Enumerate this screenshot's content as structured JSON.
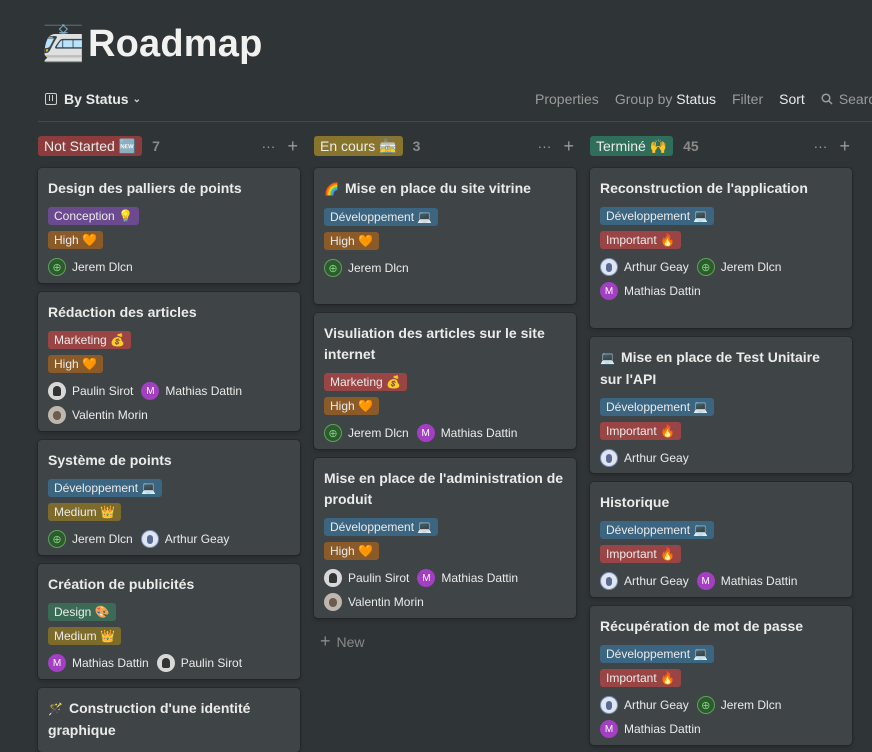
{
  "page": {
    "emoji": "🚈",
    "title": "Roadmap"
  },
  "toolbar": {
    "view_label": "By Status",
    "properties": "Properties",
    "group_prefix": "Group by",
    "group_value": "Status",
    "filter": "Filter",
    "sort": "Sort",
    "search": "Search"
  },
  "colors": {
    "not_started": "#8c3c3c",
    "en_cours": "#89742d",
    "termine": "#2e6e5a",
    "conception": "#6b4a8f",
    "high": "#8a5a28",
    "marketing": "#994545",
    "developpement": "#3b6580",
    "medium": "#7d6b2c",
    "design": "#3b6b57",
    "important": "#994545"
  },
  "columns": [
    {
      "label": "Not Started 🆕",
      "count": "7",
      "cards": [
        {
          "title": "Design des palliers de points",
          "tags": [
            [
              "Conception 💡",
              "conception"
            ],
            [
              "High 🧡",
              "high"
            ]
          ],
          "people": [
            [
              "Jerem Dlcn",
              "jerem"
            ]
          ]
        },
        {
          "title": "Rédaction des articles",
          "tags": [
            [
              "Marketing 💰",
              "marketing"
            ],
            [
              "High 🧡",
              "high"
            ]
          ],
          "people": [
            [
              "Paulin Sirot",
              "paulin"
            ],
            [
              "Mathias Dattin",
              "mathias"
            ],
            [
              "Valentin Morin",
              "valentin"
            ]
          ]
        },
        {
          "title": "Système de points",
          "tags": [
            [
              "Développement 💻",
              "developpement"
            ],
            [
              "Medium 👑",
              "medium"
            ]
          ],
          "people": [
            [
              "Jerem Dlcn",
              "jerem"
            ],
            [
              "Arthur Geay",
              "arthur"
            ]
          ]
        },
        {
          "title": "Création de publicités",
          "tags": [
            [
              "Design 🎨",
              "design"
            ],
            [
              "Medium 👑",
              "medium"
            ]
          ],
          "people": [
            [
              "Mathias Dattin",
              "mathias"
            ],
            [
              "Paulin Sirot",
              "paulin"
            ]
          ]
        },
        {
          "emoji": "🪄",
          "title": "Construction d'une identité graphique",
          "tags": [],
          "people": []
        }
      ]
    },
    {
      "label": "En cours 🚋",
      "count": "3",
      "new_label": "New",
      "cards": [
        {
          "emoji": "🌈",
          "title": "Mise en place du site vitrine",
          "tags": [
            [
              "Développement 💻",
              "developpement"
            ],
            [
              "High 🧡",
              "high"
            ]
          ],
          "people": [
            [
              "Jerem Dlcn",
              "jerem"
            ]
          ]
        },
        {
          "title": "Visuliation des articles sur le site internet",
          "tags": [
            [
              "Marketing 💰",
              "marketing"
            ],
            [
              "High 🧡",
              "high"
            ]
          ],
          "people": [
            [
              "Jerem Dlcn",
              "jerem"
            ],
            [
              "Mathias Dattin",
              "mathias"
            ]
          ]
        },
        {
          "title": "Mise en place de l'administration de produit",
          "tags": [
            [
              "Développement 💻",
              "developpement"
            ],
            [
              "High 🧡",
              "high"
            ]
          ],
          "people": [
            [
              "Paulin Sirot",
              "paulin"
            ],
            [
              "Mathias Dattin",
              "mathias"
            ],
            [
              "Valentin Morin",
              "valentin"
            ]
          ]
        }
      ]
    },
    {
      "label": "Terminé 🙌",
      "count": "45",
      "cards": [
        {
          "title": "Reconstruction de l'application",
          "tags": [
            [
              "Développement 💻",
              "developpement"
            ],
            [
              "Important 🔥",
              "important"
            ]
          ],
          "people": [
            [
              "Arthur Geay",
              "arthur"
            ],
            [
              "Jerem Dlcn",
              "jerem"
            ],
            [
              "Mathias Dattin",
              "mathias"
            ]
          ]
        },
        {
          "emoji": "💻",
          "title": "Mise en place de Test Unitaire sur l'API",
          "tags": [
            [
              "Développement 💻",
              "developpement"
            ],
            [
              "Important 🔥",
              "important"
            ]
          ],
          "people": [
            [
              "Arthur Geay",
              "arthur"
            ]
          ]
        },
        {
          "title": "Historique",
          "tags": [
            [
              "Développement 💻",
              "developpement"
            ],
            [
              "Important 🔥",
              "important"
            ]
          ],
          "people": [
            [
              "Arthur Geay",
              "arthur"
            ],
            [
              "Mathias Dattin",
              "mathias"
            ]
          ]
        },
        {
          "title": "Récupération de mot de passe",
          "tags": [
            [
              "Développement 💻",
              "developpement"
            ],
            [
              "Important 🔥",
              "important"
            ]
          ],
          "people": [
            [
              "Arthur Geay",
              "arthur"
            ],
            [
              "Jerem Dlcn",
              "jerem"
            ],
            [
              "Mathias Dattin",
              "mathias"
            ]
          ]
        }
      ]
    }
  ]
}
